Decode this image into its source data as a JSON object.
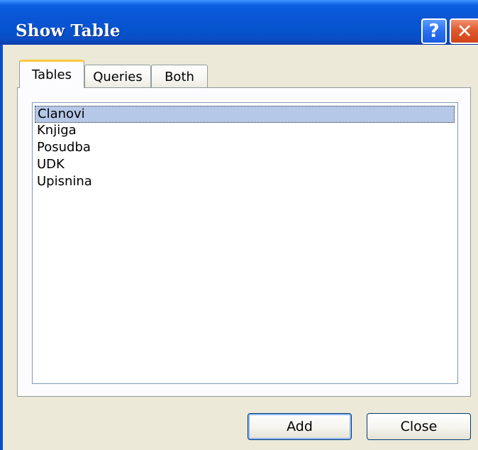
{
  "window": {
    "title": "Show Table",
    "help_button": "?",
    "close_button": "✕"
  },
  "tabs": [
    {
      "label": "Tables",
      "active": true
    },
    {
      "label": "Queries",
      "active": false
    },
    {
      "label": "Both",
      "active": false
    }
  ],
  "table_list": {
    "items": [
      "Clanovi",
      "Knjiga",
      "Posudba",
      "UDK",
      "Upisnina"
    ],
    "selected": "Clanovi"
  },
  "buttons": {
    "add": "Add",
    "close": "Close"
  },
  "colors": {
    "title_bar": "#0553cd",
    "close_button": "#e05a2e",
    "selection": "#b6c8e8",
    "active_tab_accent": "#ffc83c"
  },
  "icons": {
    "help": "help-icon",
    "close": "close-icon"
  }
}
